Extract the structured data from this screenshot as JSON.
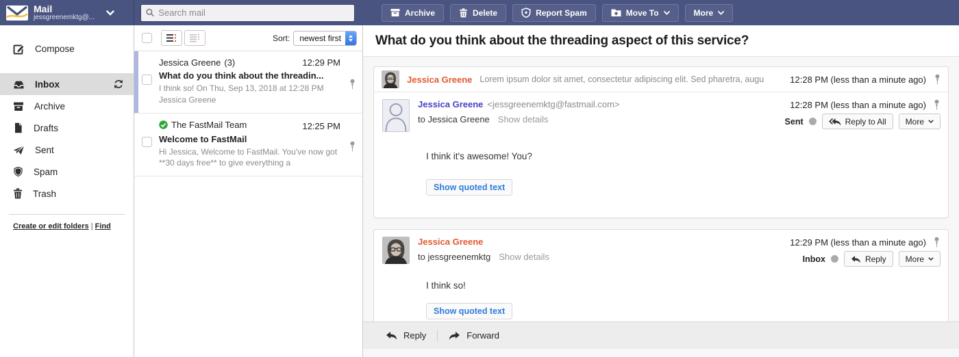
{
  "topbar": {
    "app_title": "Mail",
    "account": "jessgreenemktg@...",
    "search_placeholder": "Search mail",
    "buttons": [
      {
        "label": "Archive",
        "icon": "archive-icon"
      },
      {
        "label": "Delete",
        "icon": "trash-icon"
      },
      {
        "label": "Report Spam",
        "icon": "shield-icon"
      },
      {
        "label": "Move To",
        "icon": "folder-move-icon",
        "has_chevron": true
      },
      {
        "label": "More",
        "has_chevron": true
      }
    ]
  },
  "sidebar": {
    "compose_label": "Compose",
    "folders": [
      {
        "label": "Inbox",
        "selected": true,
        "icon": "inbox-icon"
      },
      {
        "label": "Archive",
        "icon": "archive-icon"
      },
      {
        "label": "Drafts",
        "icon": "drafts-icon"
      },
      {
        "label": "Sent",
        "icon": "sent-icon"
      },
      {
        "label": "Spam",
        "icon": "shield-icon"
      },
      {
        "label": "Trash",
        "icon": "trash-icon"
      }
    ],
    "links": [
      "Create or edit folders",
      "Find"
    ],
    "links_separator": "|"
  },
  "message_list": {
    "sort_label": "Sort:",
    "sort_value": "newest first",
    "conversations": [
      {
        "sender": "Jessica Greene",
        "count": "(3)",
        "time": "12:29 PM",
        "subject": "What do you think about the threadin...",
        "snippet": "I think so! On Thu, Sep 13, 2018 at 12:28 PM Jessica Greene",
        "selected": true
      },
      {
        "sender": "The FastMail Team",
        "time": "12:25 PM",
        "subject": "Welcome to FastMail",
        "snippet": "Hi Jessica, Welcome to FastMail. You've now got **30 days free** to give everything a",
        "verified": true
      }
    ]
  },
  "thread": {
    "subject": "What do you think about the threading aspect of this service?",
    "messages": [
      {
        "type": "collapsed",
        "sender": "Jessica Greene",
        "snippet": "Lorem ipsum dolor sit amet, consectetur adipiscing elit. Sed pharetra, augu",
        "time": "12:28 PM (less than a minute ago)"
      },
      {
        "type": "expanded",
        "sender": "Jessica Greene",
        "email": "<jessgreenemktg@fastmail.com>",
        "to": "to Jessica Greene",
        "details_link": "Show details",
        "time": "12:28 PM (less than a minute ago)",
        "folder": "Sent",
        "reply_label": "Reply to All",
        "more_label": "More",
        "body": "I think it's awesome! You?",
        "quoted_button": "Show quoted text"
      },
      {
        "type": "expanded",
        "sender": "Jessica Greene",
        "to": "to jessgreenemktg",
        "details_link": "Show details",
        "time": "12:29 PM (less than a minute ago)",
        "folder": "Inbox",
        "reply_label": "Reply",
        "more_label": "More",
        "body": "I think so!",
        "quoted_button": "Show quoted text"
      }
    ],
    "footer": {
      "reply_label": "Reply",
      "forward_label": "Forward"
    }
  },
  "colors": {
    "topbar_bg": "#4a5480",
    "selected_conversation_bar": "#aeb7e2",
    "sender_orange": "#e2592f",
    "sender_link_blue": "#4442c6",
    "action_link_blue": "#2f7cdb",
    "verified_green": "#35a33a",
    "logo_swoosh_yellow": "#f2c23e"
  }
}
